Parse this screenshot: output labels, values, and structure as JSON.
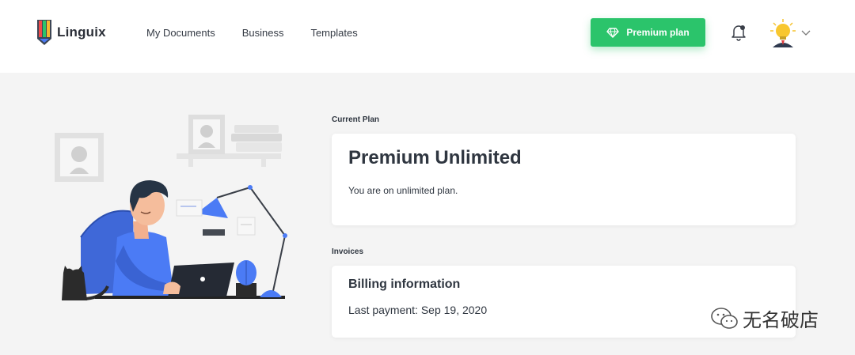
{
  "app": {
    "name": "Linguix"
  },
  "nav": {
    "items": [
      {
        "label": "My Documents"
      },
      {
        "label": "Business"
      },
      {
        "label": "Templates"
      }
    ]
  },
  "header": {
    "premium_button": "Premium plan",
    "icons": [
      "diamond-icon",
      "bell-icon",
      "user-avatar",
      "chevron-down-icon"
    ],
    "premium_color": "#2bc46b"
  },
  "current_plan": {
    "section_label": "Current Plan",
    "title": "Premium Unlimited",
    "description": "You are on unlimited plan."
  },
  "invoices": {
    "section_label": "Invoices",
    "title": "Billing information",
    "last_payment": "Last payment: Sep 19, 2020"
  },
  "watermark": {
    "text": "无名破店"
  },
  "colors": {
    "accent_blue": "#4b7bf5",
    "background": "#f4f4f4",
    "card": "#ffffff"
  }
}
